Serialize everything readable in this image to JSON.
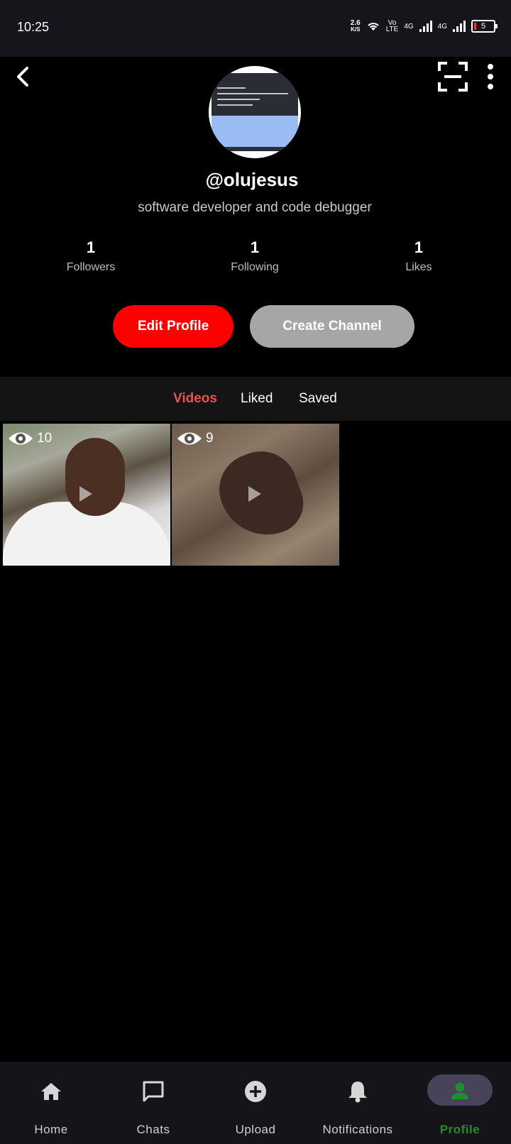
{
  "status_bar": {
    "time": "10:25",
    "net_speed": "2.6",
    "net_unit": "K/S",
    "volte_top": "Vo",
    "volte_bottom": "LTE",
    "network1": "4G",
    "network2": "4G",
    "battery": "5"
  },
  "profile": {
    "username": "@olujesus",
    "bio": "software developer and code debugger",
    "stats": [
      {
        "value": "1",
        "label": "Followers"
      },
      {
        "value": "1",
        "label": "Following"
      },
      {
        "value": "1",
        "label": "Likes"
      }
    ],
    "edit_label": "Edit Profile",
    "channel_label": "Create Channel"
  },
  "tabs": [
    "Videos",
    "Liked",
    "Saved"
  ],
  "active_tab": "Videos",
  "videos": [
    {
      "views": "10"
    },
    {
      "views": "9"
    }
  ],
  "nav": [
    {
      "label": "Home",
      "icon": "home-icon"
    },
    {
      "label": "Chats",
      "icon": "chat-icon"
    },
    {
      "label": "Upload",
      "icon": "add-circle-icon"
    },
    {
      "label": "Notifications",
      "icon": "bell-icon"
    },
    {
      "label": "Profile",
      "icon": "person-icon"
    }
  ],
  "colors": {
    "accent_red": "#ff0000",
    "active_tab": "#ef4f4f",
    "active_nav": "#1e8e2f"
  }
}
